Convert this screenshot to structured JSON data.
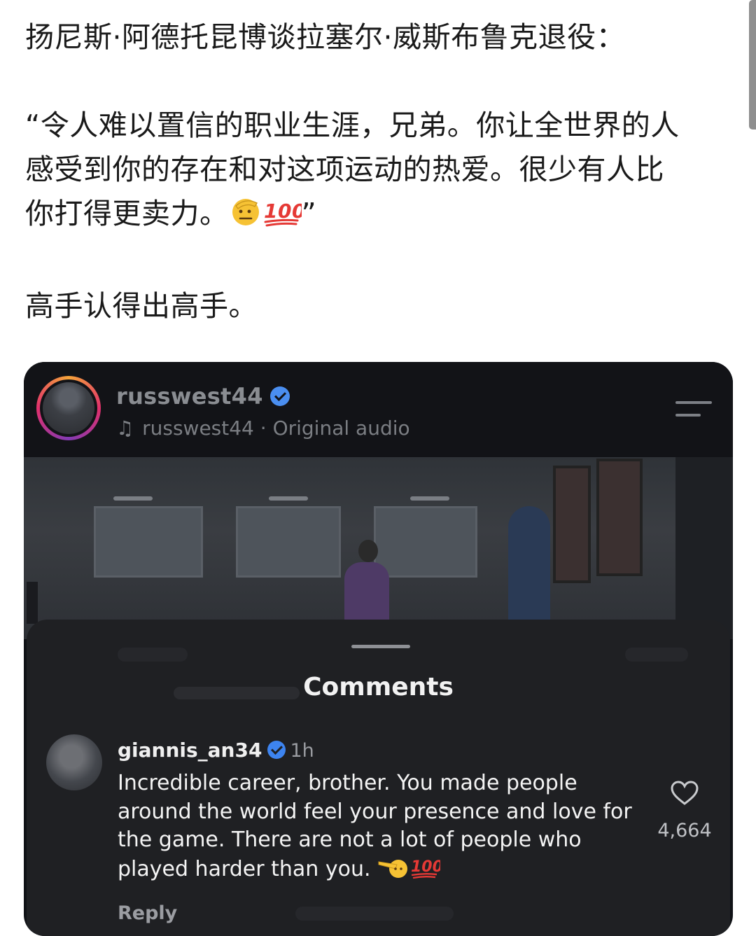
{
  "post": {
    "headline": "扬尼斯·阿德托昆博谈拉塞尔·威斯布鲁克退役：",
    "quote_lines": [
      "“令人难以置信的职业生涯，兄弟。你让全世界的人",
      "感受到你的存在和对这项运动的热爱。很少有人比",
      "你打得更卖力。"
    ],
    "quote_end": "”",
    "closing": "高手认得出高手。"
  },
  "instagram": {
    "username": "russwest44",
    "audio": "russwest44 · Original audio",
    "sheet_title": "Comments",
    "comment": {
      "username": "giannis_an34",
      "time": "1h",
      "text": "Incredible career, brother. You made people around the world feel your presence and love for the game. There are not a lot of people who played harder than you.",
      "likes": "4,664",
      "reply_label": "Reply"
    }
  },
  "colors": {
    "verified": "#4a8ef0",
    "story_ring": "#e1306c",
    "hundred_emoji": "#e53935"
  }
}
